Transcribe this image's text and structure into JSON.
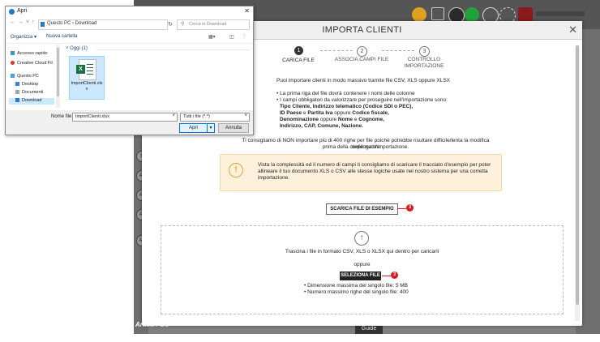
{
  "dialog": {
    "title": "Apri",
    "nav": {
      "address": "Questo PC  ›  Download",
      "search_placeholder": "Cerca in Download"
    },
    "toolbar": {
      "organize": "Organizza ▾",
      "new_folder": "Nuova cartella"
    },
    "sidebar": [
      "Accesso rapido",
      "Creative Cloud Fil",
      "Questo PC",
      "Desktop",
      "Documenti",
      "Download"
    ],
    "group_label": "Oggi (1)",
    "file": {
      "name": "ImportClienti.xlsx"
    },
    "filename_label": "Nome file:",
    "filename_value": "ImportClienti.xlsx",
    "filetype_value": "Tutti i file (*.*)",
    "open_label": "Apri",
    "cancel_label": "Annulla"
  },
  "modal": {
    "title": "IMPORTA CLIENTI",
    "steps": [
      {
        "num": "1",
        "label": "CARICA FILE"
      },
      {
        "num": "2",
        "label": "ASSOCIA CAMPI FILE"
      },
      {
        "num": "3",
        "label": "CONTROLLO IMPORTAZIONE"
      }
    ],
    "intro": "Puoi importare clienti in modo massivo tramite file CSV, XLS oppure XLSX",
    "rule1": "• La prima riga del file dovrà contenere i nomi delle colonne",
    "rule2": "• I campi obbligatori da valorizzare per proseguire nell'importazione sono:",
    "req1": "Tipo Cliente, Indirizzo telematico (Codice SDI o PEC),",
    "req2a": "ID Paese",
    "req2b": " e ",
    "req2c": "Partita Iva",
    "req2d": " oppure ",
    "req2e": "Codice fiscale,",
    "req3a": "Denominazione",
    "req3b": " oppure ",
    "req3c": "Nome",
    "req3d": " e ",
    "req3e": "Cognome,",
    "req4": "Indirizzo, CAP, Comune, Nazione.",
    "advice1": "Ti consigliamo di NON importare più di 400 righe per file poichè potrebbe risultare difficile/lenta la modifica riepilogativa",
    "advice2": "prima della conferma d'importazione.",
    "warning_icon": "!",
    "warning1": "Vista la complessità ed il numero di campi ti consigliamo di scaricare il tracciato d'esempio per poter",
    "warning2": "allineare il tuo documento XLS o CSV alle stesse logiche usate nel nostro sistema per una corretta",
    "warning3": "importazione.",
    "download_label": "SCARICA FILE DI ESEMPIO",
    "badge": "3",
    "drop_icon": "↑",
    "drop_text": "Trascina i file in formato CSV, XLS o XLSX qui dentro per caricarli",
    "or_text": "oppure",
    "select_label": "SELEZIONA FILE",
    "max_size": "• Dimensione massima del singolo file: 5 MB",
    "max_rows": "• Numero massimo righe del singolo file: 400"
  },
  "background": {
    "brand": "Aruba PEC",
    "guide_label": "Guide",
    "side_icons": [
      "$",
      "Ag",
      "Ag",
      "Ag",
      "AZ"
    ]
  },
  "colors": {
    "accent_red": "#d71920",
    "warning_bg": "#fdf1dc",
    "excel_green": "#1d6f42"
  }
}
